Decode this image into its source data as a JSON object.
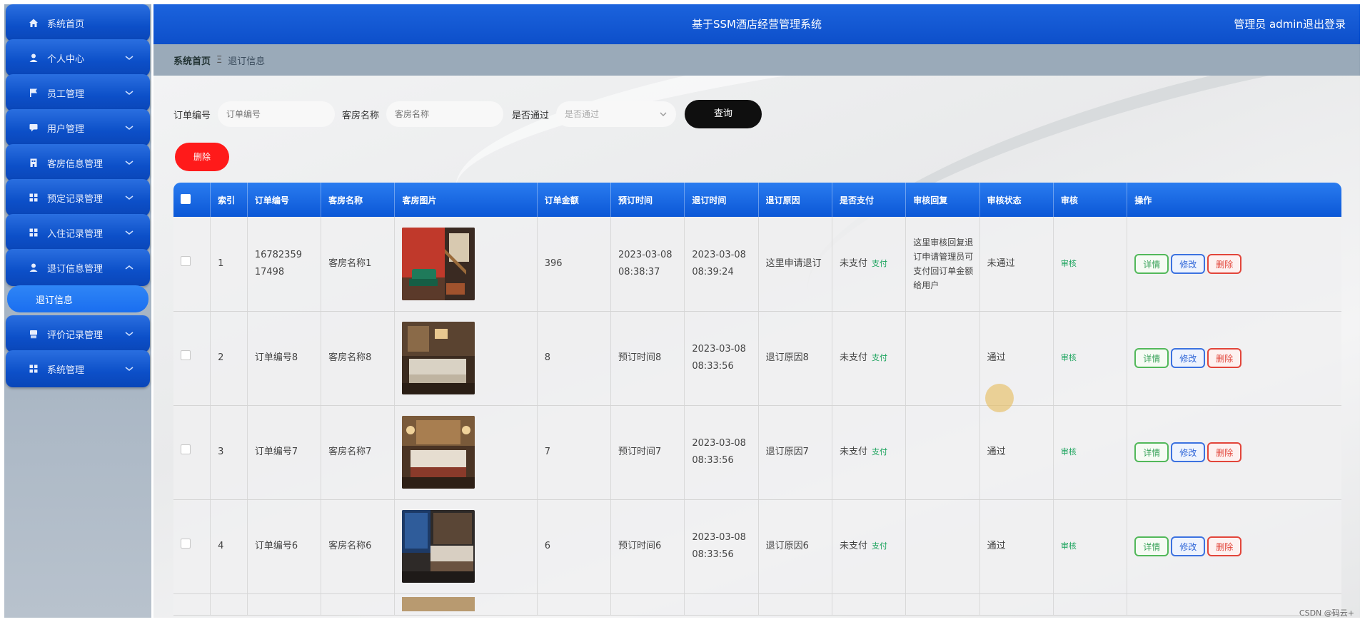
{
  "sidebar": {
    "items": [
      {
        "label": "系统首页",
        "icon": "home-icon"
      },
      {
        "label": "个人中心",
        "icon": "user-icon"
      },
      {
        "label": "员工管理",
        "icon": "flag-icon"
      },
      {
        "label": "用户管理",
        "icon": "chat-icon"
      },
      {
        "label": "客房信息管理",
        "icon": "building-icon"
      },
      {
        "label": "预定记录管理",
        "icon": "grid-icon"
      },
      {
        "label": "入住记录管理",
        "icon": "grid-icon"
      },
      {
        "label": "退订信息管理",
        "icon": "user-icon"
      },
      {
        "label": "评价记录管理",
        "icon": "comment-icon"
      },
      {
        "label": "系统管理",
        "icon": "grid-icon"
      }
    ],
    "active_sub": "退订信息"
  },
  "header": {
    "title": "基于SSM酒店经营管理系统",
    "user": "管理员 admin",
    "logout": "退出登录"
  },
  "breadcrumb": {
    "home": "系统首页",
    "separator": "Ξ",
    "current": "退订信息"
  },
  "search": {
    "order_label": "订单编号",
    "order_placeholder": "订单编号",
    "room_label": "客房名称",
    "room_placeholder": "客房名称",
    "pass_label": "是否通过",
    "pass_placeholder": "是否通过",
    "query_button": "查询"
  },
  "batch_delete": "删除",
  "table": {
    "headers": [
      "索引",
      "订单编号",
      "客房名称",
      "客房图片",
      "订单金额",
      "预订时间",
      "退订时间",
      "退订原因",
      "是否支付",
      "审核回复",
      "审核状态",
      "审核",
      "操作"
    ],
    "rows": [
      {
        "index": "1",
        "order": "1678235917498",
        "room": "客房名称1",
        "amount": "396",
        "book_time": "2023-03-08 08:38:37",
        "cancel_time": "2023-03-08 08:39:24",
        "reason": "这里申请退订",
        "paid": "未支付",
        "pay_link": "支付",
        "reply": "这里审核回复退订申请管理员可支付回订单金额给用户",
        "status": "未通过",
        "audit": "审核",
        "photo": "red-room-photo"
      },
      {
        "index": "2",
        "order": "订单编号8",
        "room": "客房名称8",
        "amount": "8",
        "book_time": "预订时间8",
        "cancel_time": "2023-03-08 08:33:56",
        "reason": "退订原因8",
        "paid": "未支付",
        "pay_link": "支付",
        "reply": "",
        "status": "通过",
        "audit": "审核",
        "photo": "hotel-room-photo"
      },
      {
        "index": "3",
        "order": "订单编号7",
        "room": "客房名称7",
        "amount": "7",
        "book_time": "预订时间7",
        "cancel_time": "2023-03-08 08:33:56",
        "reason": "退订原因7",
        "paid": "未支付",
        "pay_link": "支付",
        "reply": "",
        "status": "通过",
        "audit": "审核",
        "photo": "hotel-room-photo"
      },
      {
        "index": "4",
        "order": "订单编号6",
        "room": "客房名称6",
        "amount": "6",
        "book_time": "预订时间6",
        "cancel_time": "2023-03-08 08:33:56",
        "reason": "退订原因6",
        "paid": "未支付",
        "pay_link": "支付",
        "reply": "",
        "status": "通过",
        "audit": "审核",
        "photo": "hotel-room-photo"
      }
    ],
    "actions": {
      "detail": "详情",
      "edit": "修改",
      "delete": "删除"
    }
  },
  "watermark": "CSDN @码云+",
  "colors": {
    "primary": "#0d4fca",
    "danger": "#ff1a1a",
    "success": "#1aa35c",
    "query_bg": "#0f0f0f"
  }
}
